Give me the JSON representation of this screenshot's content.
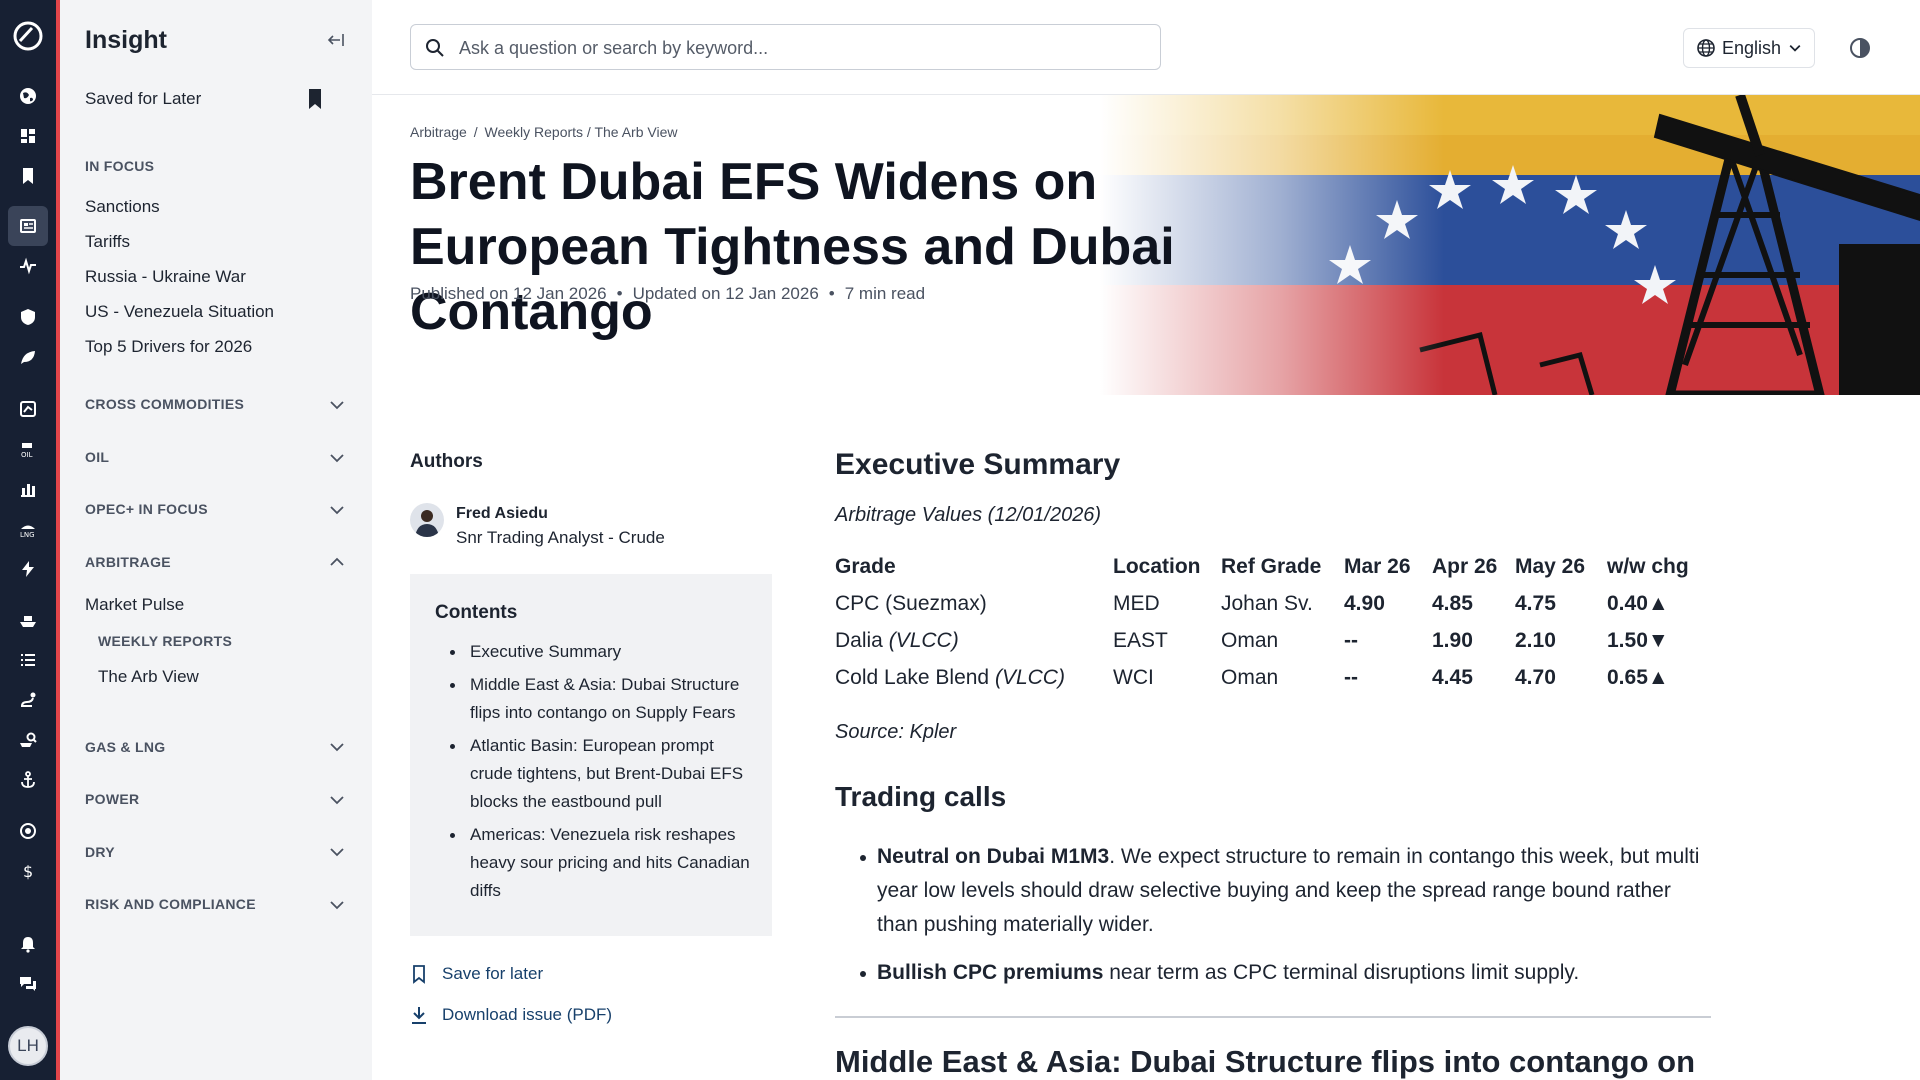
{
  "sidebar": {
    "title": "Insight",
    "saved": "Saved for Later",
    "in_focus": {
      "label": "IN FOCUS",
      "items": [
        "Sanctions",
        "Tariffs",
        "Russia - Ukraine War",
        "US - Venezuela Situation",
        "Top 5 Drivers for 2026"
      ]
    },
    "sections": {
      "cross": "CROSS COMMODITIES",
      "oil": "OIL",
      "opec": "OPEC+ IN FOCUS",
      "arbitrage": "ARBITRAGE",
      "gas": "GAS & LNG",
      "power": "POWER",
      "dry": "DRY",
      "risk": "RISK AND COMPLIANCE"
    },
    "arbitrage_items": {
      "market_pulse": "Market Pulse",
      "weekly_reports": "WEEKLY REPORTS",
      "arb_view": "The Arb View"
    }
  },
  "rail": {
    "avatar_initials": "LH",
    "accent_color": "#e3454a"
  },
  "header": {
    "search_placeholder": "Ask a question or search by keyword...",
    "language": "English"
  },
  "article": {
    "breadcrumb": [
      "Arbitrage",
      "/",
      "Weekly Reports / The Arb View"
    ],
    "title": "Brent Dubai EFS Widens on European Tightness and Dubai Contango",
    "published": "Published on 12 Jan 2026",
    "updated": "Updated on 12 Jan 2026",
    "read_time": "7 min read",
    "bullet": "•"
  },
  "authors": {
    "heading": "Authors",
    "name": "Fred Asiedu",
    "role": "Snr Trading Analyst - Crude"
  },
  "contents": {
    "heading": "Contents",
    "items": [
      "Executive Summary",
      "Middle East & Asia: Dubai Structure flips into contango on Supply Fears",
      "Atlantic Basin: European prompt crude tightens, but Brent-Dubai EFS blocks the eastbound pull",
      "Americas: Venezuela risk reshapes heavy sour pricing and hits Canadian diffs"
    ]
  },
  "actions": {
    "save": "Save for later",
    "download": "Download issue (PDF)"
  },
  "exec_summary": {
    "heading": "Executive Summary",
    "caption": "Arbitrage Values (12/01/2026)",
    "headers": [
      "Grade",
      "Location",
      "Ref Grade",
      "Mar 26",
      "Apr 26",
      "May 26",
      "w/w chg"
    ],
    "rows": [
      {
        "grade": "CPC (Suezmax)",
        "grade_suffix": "",
        "location": "MED",
        "ref": "Johan Sv.",
        "mar": "4.90",
        "apr": "4.85",
        "may": "4.75",
        "chg": "0.40▲"
      },
      {
        "grade": "Dalia ",
        "grade_suffix": "(VLCC)",
        "location": "EAST",
        "ref": "Oman",
        "mar": "--",
        "apr": "1.90",
        "may": "2.10",
        "chg": "1.50▼"
      },
      {
        "grade": "Cold Lake Blend ",
        "grade_suffix": "(VLCC)",
        "location": "WCI",
        "ref": "Oman",
        "mar": "--",
        "apr": "4.45",
        "may": "4.70",
        "chg": "0.65▲"
      }
    ],
    "source": "Source: Kpler"
  },
  "trading_calls": {
    "heading": "Trading calls",
    "items": [
      {
        "bold": "Neutral on Dubai M1M3",
        "text": ". We expect structure to remain in contango this week, but multi year low levels should draw selective buying and keep the spread range bound rather than pushing materially wider."
      },
      {
        "bold": "Bullish CPC premiums",
        "text": " near term as CPC terminal disruptions limit supply."
      }
    ]
  },
  "next_heading": "Middle East & Asia: Dubai Structure flips into contango on"
}
